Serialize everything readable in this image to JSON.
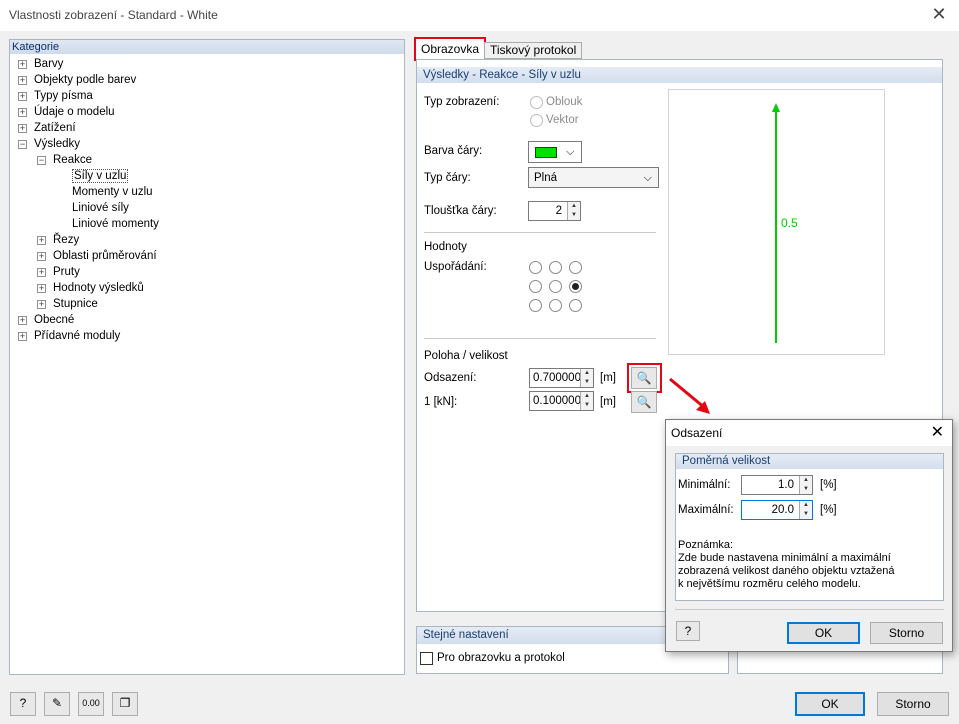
{
  "window": {
    "title": "Vlastnosti zobrazení - Standard - White",
    "close": "✕"
  },
  "tree": {
    "header": "Kategorie",
    "items": [
      {
        "label": "Barvy",
        "exp": "+"
      },
      {
        "label": "Objekty podle barev",
        "exp": "+"
      },
      {
        "label": "Typy písma",
        "exp": "+"
      },
      {
        "label": "Údaje o modelu",
        "exp": "+"
      },
      {
        "label": "Zatížení",
        "exp": "+"
      },
      {
        "label": "Výsledky",
        "exp": "−"
      },
      {
        "label": "Reakce",
        "exp": "−"
      },
      {
        "label": "Síly v uzlu",
        "exp": ""
      },
      {
        "label": "Momenty v uzlu",
        "exp": ""
      },
      {
        "label": "Liniové síly",
        "exp": ""
      },
      {
        "label": "Liniové momenty",
        "exp": ""
      },
      {
        "label": "Řezy",
        "exp": "+"
      },
      {
        "label": "Oblasti průměrování",
        "exp": "+"
      },
      {
        "label": "Pruty",
        "exp": "+"
      },
      {
        "label": "Hodnoty výsledků",
        "exp": "+"
      },
      {
        "label": "Stupnice",
        "exp": "+"
      },
      {
        "label": "Obecné",
        "exp": "+"
      },
      {
        "label": "Přídavné moduly",
        "exp": "+"
      }
    ]
  },
  "tabs": {
    "screen": "Obrazovka",
    "print": "Tiskový protokol"
  },
  "section": {
    "header": "Výsledky - Reakce - Síly v uzlu",
    "display_type_label": "Typ zobrazení:",
    "opt_arc": "Oblouk",
    "opt_vector": "Vektor",
    "line_color_label": "Barva čáry:",
    "line_color": "#00e000",
    "line_type_label": "Typ čáry:",
    "line_type_value": "Plná",
    "line_width_label": "Tloušťka čáry:",
    "line_width_value": "2",
    "values_header": "Hodnoty",
    "arrangement_label": "Uspořádání:",
    "arrangement_selected": "middle-right",
    "position_header": "Poloha / velikost",
    "offset_label": "Odsazení:",
    "offset_value": "0.700000",
    "offset_unit": "[m]",
    "scale_label": "1  [kN]:",
    "scale_value": "0.100000",
    "scale_unit": "[m]"
  },
  "preview": {
    "value_label": "0.5",
    "arrow_color": "#00cc00"
  },
  "same_settings": {
    "header": "Stejné nastavení",
    "checkbox_label": "Pro obrazovku a protokol",
    "checked": false
  },
  "footer": {
    "ok": "OK",
    "cancel": "Storno"
  },
  "popup": {
    "title": "Odsazení",
    "close": "✕",
    "section": "Poměrná velikost",
    "min_label": "Minimální:",
    "min_value": "1.0",
    "max_label": "Maximální:",
    "max_value": "20.0",
    "unit": "[%]",
    "note_title": "Poznámka:",
    "note_line1": "Zde bude nastavena minimální a maximální",
    "note_line2": "zobrazená velikost daného objektu vztažená",
    "note_line3": "k největšímu rozměru celého modelu.",
    "ok": "OK",
    "cancel": "Storno"
  },
  "icons": {
    "help": "help-icon",
    "edit": "edit-icon",
    "units": "units-icon",
    "copy": "copy-icon",
    "magnifier": "magnifier-icon"
  },
  "accent_red": "#e30613"
}
